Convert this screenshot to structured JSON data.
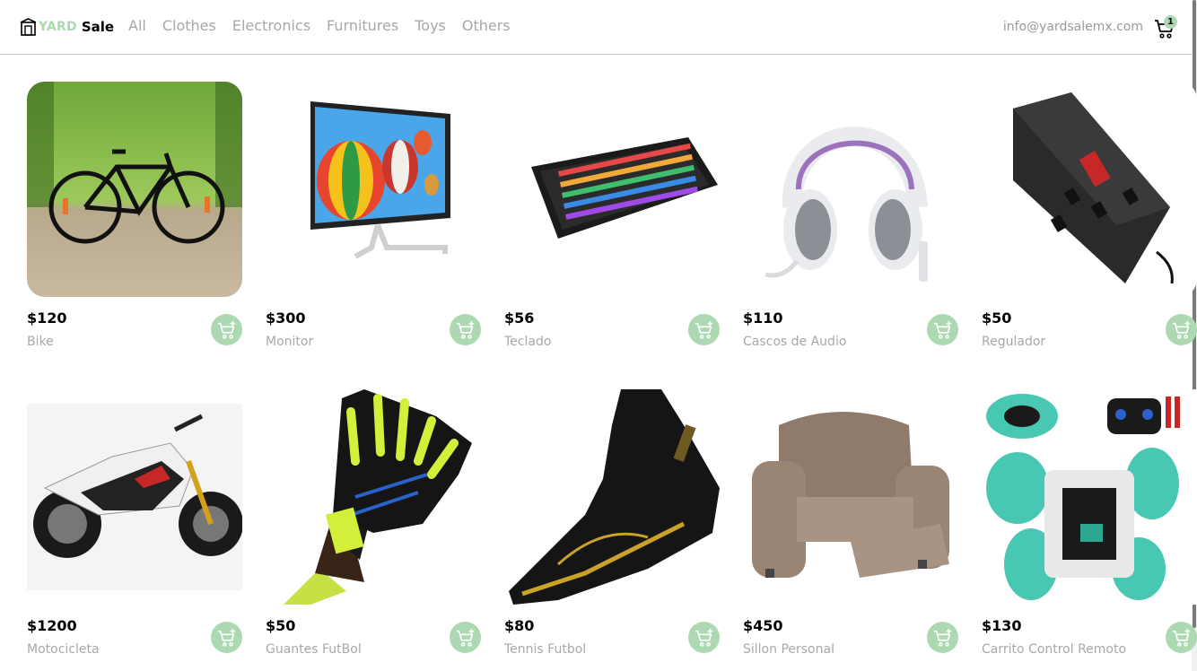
{
  "header": {
    "logo_yard": "YARD",
    "logo_sale": "Sale",
    "categories": [
      "All",
      "Clothes",
      "Electronics",
      "Furnitures",
      "Toys",
      "Others"
    ],
    "email": "info@yardsalemx.com",
    "cart_count": "1"
  },
  "colors": {
    "accent": "#acd9b2",
    "muted_text": "#a8a8a8",
    "divider": "#c8c8c8"
  },
  "products": [
    {
      "price": "$120",
      "name": "Bike",
      "image": "bike-image"
    },
    {
      "price": "$300",
      "name": "Monitor",
      "image": "monitor-image"
    },
    {
      "price": "$56",
      "name": "Teclado",
      "image": "keyboard-image"
    },
    {
      "price": "$110",
      "name": "Cascos de Audio",
      "image": "headset-image"
    },
    {
      "price": "$50",
      "name": "Regulador",
      "image": "regulator-image"
    },
    {
      "price": "$1200",
      "name": "Motocicleta",
      "image": "motorcycle-image"
    },
    {
      "price": "$50",
      "name": "Guantes FutBol",
      "image": "gloves-image"
    },
    {
      "price": "$80",
      "name": "Tennis Futbol",
      "image": "shoe-image"
    },
    {
      "price": "$450",
      "name": "Sillon Personal",
      "image": "armchair-image"
    },
    {
      "price": "$130",
      "name": "Carrito Control Remoto",
      "image": "rc-car-image"
    }
  ]
}
